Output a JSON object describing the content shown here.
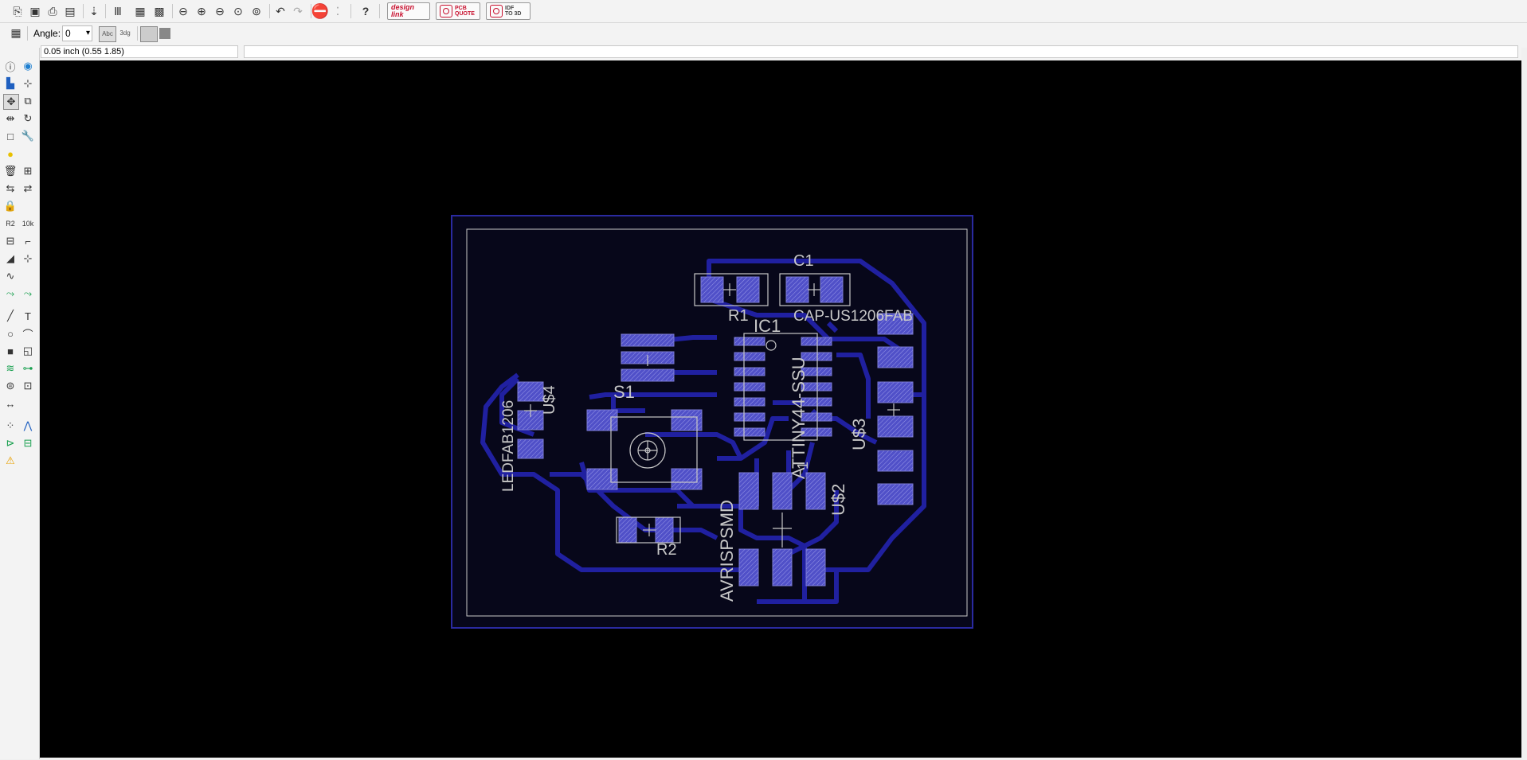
{
  "toolbar": {
    "design_link": [
      "design",
      "link"
    ],
    "pcb_quote": [
      "PCB",
      "QUOTE"
    ],
    "idf_to_3d": [
      "IDF",
      "TO 3D"
    ]
  },
  "param_bar": {
    "angle_label": "Angle:",
    "angle_value": "0",
    "text_style_label": "Abc",
    "text_style_alt": "3dg"
  },
  "coordinate_readout": "0.05 inch (0.55 1.85)",
  "board": {
    "labels": {
      "c1": "C1",
      "r1": "R1",
      "cap": "CAP-US1206FAB",
      "ic1": "IC1",
      "attiny": "ATTINY44-SSU",
      "s1": "S1",
      "u4": "U$4",
      "ledfab": "LEDFAB1206",
      "u3": "U$3",
      "u2": "U$2",
      "one": "1",
      "r2": "R2",
      "avrisp": "AVRISPSMD"
    },
    "colors": {
      "background": "#000000",
      "copper": "#2020a0",
      "pad": "#5050c8",
      "silkscreen": "#c8c8c8",
      "outline": "#2a2aa0"
    }
  }
}
